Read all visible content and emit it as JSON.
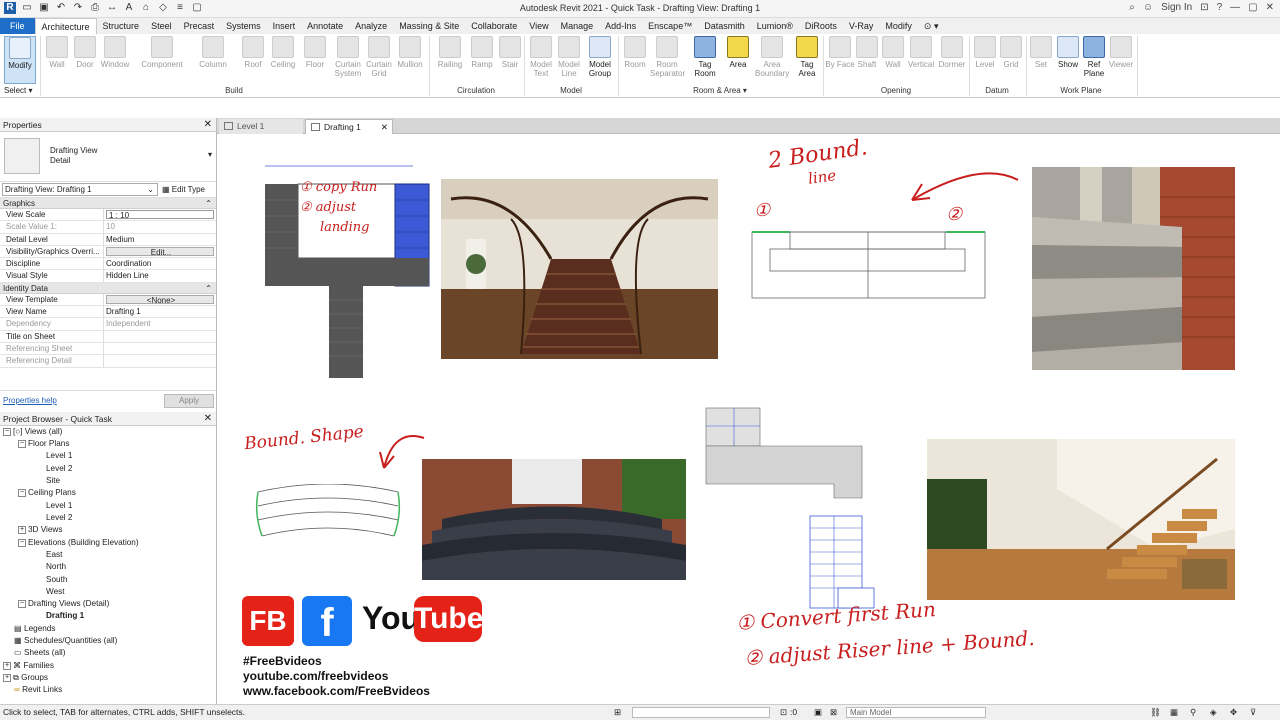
{
  "window": {
    "title": "Autodesk Revit 2021 - Quick Task - Drafting View: Drafting 1",
    "sign_in": "Sign In"
  },
  "ribbon_tabs": [
    "File",
    "Architecture",
    "Structure",
    "Steel",
    "Precast",
    "Systems",
    "Insert",
    "Annotate",
    "Analyze",
    "Massing & Site",
    "Collaborate",
    "View",
    "Manage",
    "Add-Ins",
    "Enscape™",
    "Datasmith",
    "Lumion®",
    "DiRoots",
    "V-Ray",
    "Modify"
  ],
  "ribbon": {
    "modify": "Modify",
    "select": "Select ▾",
    "build": [
      "Wall",
      "Door",
      "Window",
      "Component",
      "Column",
      "Roof",
      "Ceiling",
      "Floor",
      "Curtain System",
      "Curtain Grid",
      "Mullion"
    ],
    "circulation": [
      "Railing",
      "Ramp",
      "Stair"
    ],
    "model": [
      "Model Text",
      "Model Line",
      "Model Group"
    ],
    "room_area": [
      "Room",
      "Room Separator",
      "Tag Room",
      "Area",
      "Area Boundary",
      "Tag Area"
    ],
    "opening": [
      "By Face",
      "Shaft",
      "Wall",
      "Vertical",
      "Dormer"
    ],
    "datum": [
      "Level",
      "Grid"
    ],
    "work_plane": [
      "Set",
      "Show",
      "Ref Plane",
      "Viewer"
    ],
    "panels": {
      "build": "Build",
      "circulation": "Circulation",
      "model": "Model",
      "room_area": "Room & Area ▾",
      "opening": "Opening",
      "datum": "Datum",
      "work_plane": "Work Plane"
    }
  },
  "properties": {
    "title": "Properties",
    "type_name_1": "Drafting View",
    "type_name_2": "Detail",
    "instance": "Drafting View: Drafting 1",
    "edit_type": "Edit Type",
    "graphics_group": "Graphics",
    "identity_group": "Identity Data",
    "rows": [
      {
        "k": "View Scale",
        "v": "1 : 10"
      },
      {
        "k": "Scale Value    1:",
        "v": "10"
      },
      {
        "k": "Detail Level",
        "v": "Medium"
      },
      {
        "k": "Visibility/Graphics Overri...",
        "v": "Edit..."
      },
      {
        "k": "Discipline",
        "v": "Coordination"
      },
      {
        "k": "Visual Style",
        "v": "Hidden Line"
      }
    ],
    "identity_rows": [
      {
        "k": "View Template",
        "v": "<None>"
      },
      {
        "k": "View Name",
        "v": "Drafting 1"
      },
      {
        "k": "Dependency",
        "v": "Independent"
      },
      {
        "k": "Title on Sheet",
        "v": ""
      },
      {
        "k": "Referencing Sheet",
        "v": ""
      },
      {
        "k": "Referencing Detail",
        "v": ""
      }
    ],
    "help": "Properties help",
    "apply": "Apply"
  },
  "project_browser": {
    "title": "Project Browser - Quick Task",
    "items": [
      "Views (all)",
      "Floor Plans",
      "Level 1",
      "Level 2",
      "Site",
      "Ceiling Plans",
      "Level 1",
      "Level 2",
      "3D Views",
      "Elevations (Building Elevation)",
      "East",
      "North",
      "South",
      "West",
      "Drafting Views (Detail)",
      "Drafting 1",
      "Legends",
      "Schedules/Quantities (all)",
      "Sheets (all)",
      "Families",
      "Groups",
      "Revit Links"
    ]
  },
  "view_tabs": [
    "Level 1",
    "Drafting 1"
  ],
  "annotations": {
    "a1_line1": "① copy Run",
    "a1_line2": "② adjust",
    "a1_line3": "landing",
    "a2_line1": "2 Bound.",
    "a2_line2": "line",
    "a2_n1": "①",
    "a2_n2": "②",
    "a3": "Bound. Shape",
    "a4_line1": "① Convert  first  Run",
    "a4_line2": "② adjust  Riser line + Bound."
  },
  "social": {
    "logo_fb": "FB",
    "logo_f": "f",
    "logo_you": "You",
    "logo_tube": "Tube",
    "hashtag": "#FreeBvideos",
    "youtube_url": "youtube.com/freebvideos",
    "facebook_url": "www.facebook.com/FreeBvideos"
  },
  "status_bar": {
    "message": "Click to select, TAB for alternates, CTRL adds, SHIFT unselects.",
    "zero1": ":0",
    "model": "Main Model"
  },
  "colors": {
    "accent": "#1e6ec8",
    "handwriting": "#c81e1e",
    "stair_fill": "#555555",
    "stair_highlight": "#3d5ad6"
  }
}
